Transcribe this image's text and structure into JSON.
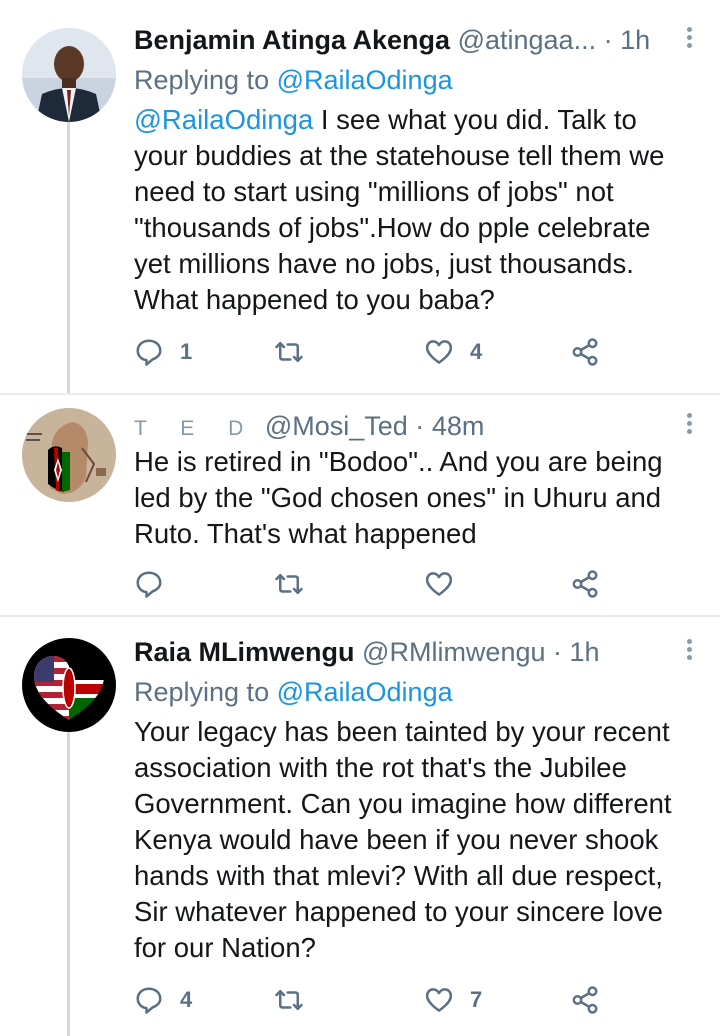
{
  "tweets": [
    {
      "name": "Benjamin Atinga Akenga",
      "handle": "@atingaa...",
      "dot": "·",
      "time": "1h",
      "replying_prefix": "Replying to ",
      "replying_to": "@RailaOdinga",
      "mention": "@RailaOdinga",
      "text": " I see what you did. Talk to\nyour buddies at the statehouse tell them we\nneed to start using \"millions of jobs\" not\n\"thousands of jobs\".How do pple celebrate\nyet millions have no jobs, just thousands.\nWhat happened to you baba?",
      "replies": "1",
      "retweets": "",
      "likes": "4"
    },
    {
      "name": "T E D",
      "handle": "@Mosi_Ted",
      "dot": "·",
      "time": "48m",
      "text": "He is retired in \"Bodoo\".. And you are being\nled by the \"God chosen ones\" in Uhuru and\nRuto. That's what happened",
      "replies": "",
      "retweets": "",
      "likes": ""
    },
    {
      "name": "Raia MLimwengu",
      "handle": "@RMlimwengu",
      "dot": "·",
      "time": "1h",
      "replying_prefix": "Replying to ",
      "replying_to": "@RailaOdinga",
      "text": "Your legacy has been tainted by your recent\nassociation with the rot that's the Jubilee\nGovernment. Can you imagine how different\nKenya would have been if you never shook\nhands with that mlevi? With all due respect,\nSir whatever happened to your sincere love\nfor our Nation?",
      "replies": "4",
      "retweets": "",
      "likes": "7"
    }
  ],
  "icons": {
    "reply": "reply-icon",
    "retweet": "retweet-icon",
    "like": "heart-icon",
    "share": "share-icon",
    "more": "more-options-icon"
  },
  "colors": {
    "icon_gray": "#5b7083",
    "link_blue": "#1b95e0",
    "separator": "#e6ecf0"
  }
}
